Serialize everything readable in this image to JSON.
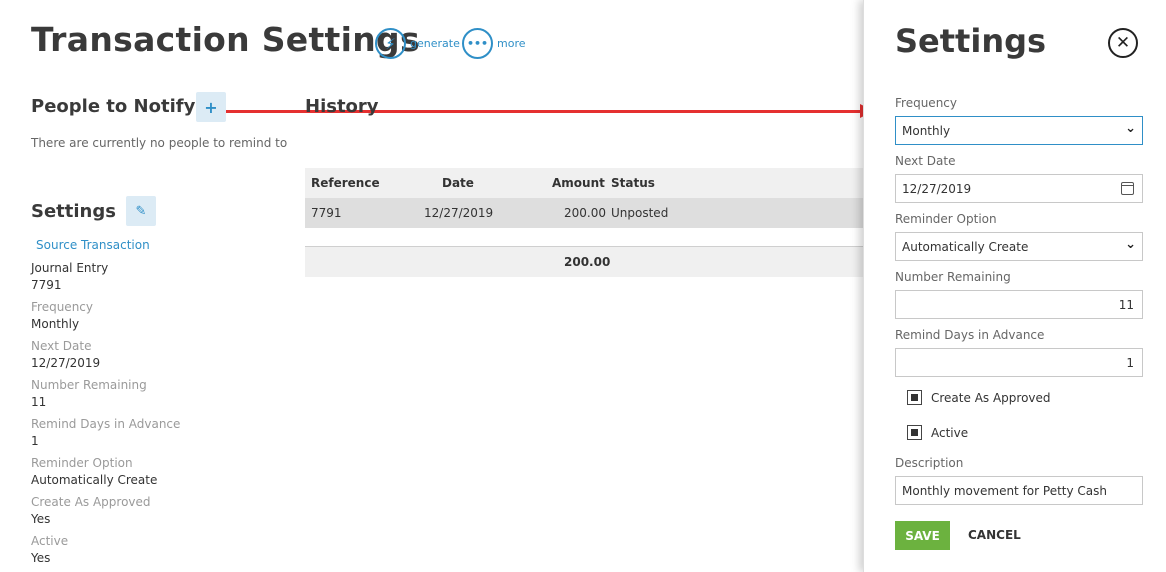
{
  "header": {
    "title": "Transaction Settings",
    "actions": [
      {
        "label": "generate",
        "icon": "lightning-icon"
      },
      {
        "label": "more",
        "icon": "more-dots-icon"
      }
    ]
  },
  "people": {
    "title": "People to Notify",
    "empty_text": "There are currently no people to remind to",
    "add_icon": "plus-icon"
  },
  "history": {
    "title": "History",
    "columns": [
      "Reference",
      "Date",
      "Amount",
      "Status"
    ],
    "rows": [
      {
        "reference": "7791",
        "date": "12/27/2019",
        "amount": "200.00",
        "status": "Unposted"
      }
    ],
    "total": "200.00"
  },
  "settings_summary": {
    "title": "Settings",
    "edit_icon": "pencil-icon",
    "source_link": "Source Transaction",
    "source_type": "Journal Entry",
    "source_ref": "7791",
    "fields": [
      {
        "label": "Frequency",
        "value": "Monthly"
      },
      {
        "label": "Next Date",
        "value": "12/27/2019"
      },
      {
        "label": "Number Remaining",
        "value": "11"
      },
      {
        "label": "Remind Days in Advance",
        "value": "1"
      },
      {
        "label": "Reminder Option",
        "value": "Automatically Create"
      },
      {
        "label": "Create As Approved",
        "value": "Yes"
      },
      {
        "label": "Active",
        "value": "Yes"
      }
    ]
  },
  "panel": {
    "title": "Settings",
    "close_icon": "close-icon",
    "frequency": {
      "label": "Frequency",
      "value": "Monthly"
    },
    "next_date": {
      "label": "Next Date",
      "value": "12/27/2019"
    },
    "reminder_option": {
      "label": "Reminder Option",
      "value": "Automatically Create"
    },
    "number_remaining": {
      "label": "Number Remaining",
      "value": "11"
    },
    "remind_days": {
      "label": "Remind Days in Advance",
      "value": "1"
    },
    "create_as_approved": {
      "label": "Create As Approved",
      "checked": true
    },
    "active": {
      "label": "Active",
      "checked": true
    },
    "description": {
      "label": "Description",
      "value": "Monthly movement for Petty Cash"
    },
    "save_label": "SAVE",
    "cancel_label": "CANCEL"
  },
  "colors": {
    "accent": "#2f8fc7",
    "save": "#6cb23f",
    "arrow": "#e53030"
  }
}
